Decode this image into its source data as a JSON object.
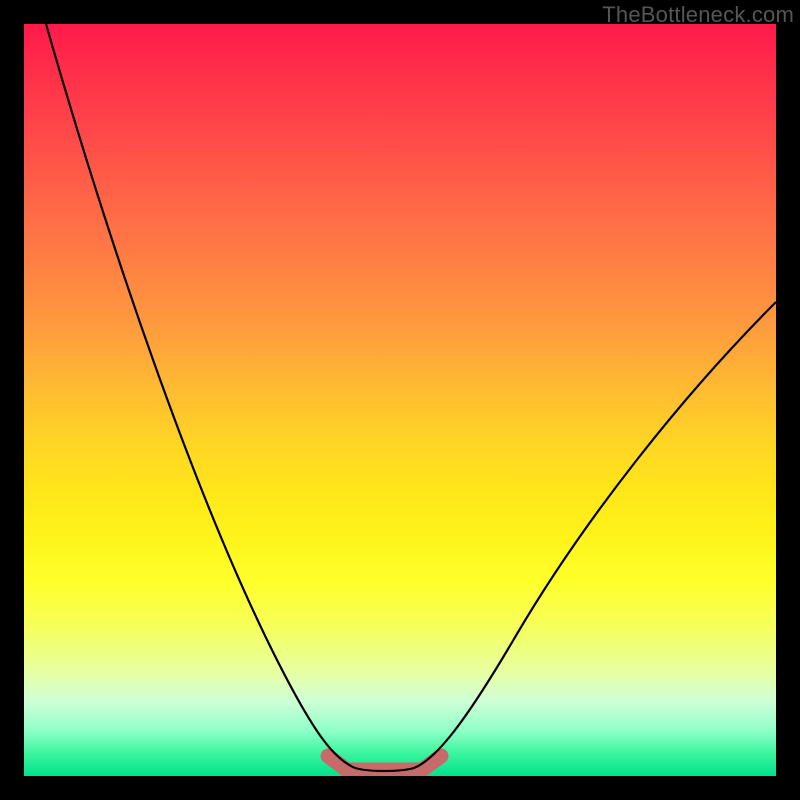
{
  "watermark": "TheBottleneck.com",
  "chart_data": {
    "type": "line",
    "title": "",
    "xlabel": "",
    "ylabel": "",
    "xlim": [
      0,
      100
    ],
    "ylim": [
      0,
      100
    ],
    "series": [
      {
        "name": "left-curve",
        "x": [
          3,
          6,
          10,
          14,
          18,
          22,
          26,
          30,
          34,
          38,
          40.5,
          43
        ],
        "y": [
          100,
          90,
          78,
          66,
          55,
          44,
          34,
          25,
          16,
          7,
          2.5,
          0.8
        ]
      },
      {
        "name": "valley-floor",
        "x": [
          43,
          46,
          50,
          53
        ],
        "y": [
          0.8,
          0.6,
          0.6,
          0.8
        ]
      },
      {
        "name": "right-curve",
        "x": [
          53,
          56,
          60,
          66,
          72,
          78,
          84,
          90,
          96,
          100
        ],
        "y": [
          0.8,
          2.5,
          7,
          15,
          24,
          33,
          42,
          51,
          59,
          63
        ]
      },
      {
        "name": "goal-band-left",
        "x": [
          40.5,
          43
        ],
        "y": [
          2.5,
          0.8
        ]
      },
      {
        "name": "goal-band-right",
        "x": [
          53,
          55.5
        ],
        "y": [
          0.8,
          2.5
        ]
      }
    ],
    "annotations": [],
    "colors": {
      "curve": "#000000",
      "goal_marker": "#c96a6a",
      "gradient_top": "#ff1a4b",
      "gradient_bottom": "#00e38a"
    }
  }
}
